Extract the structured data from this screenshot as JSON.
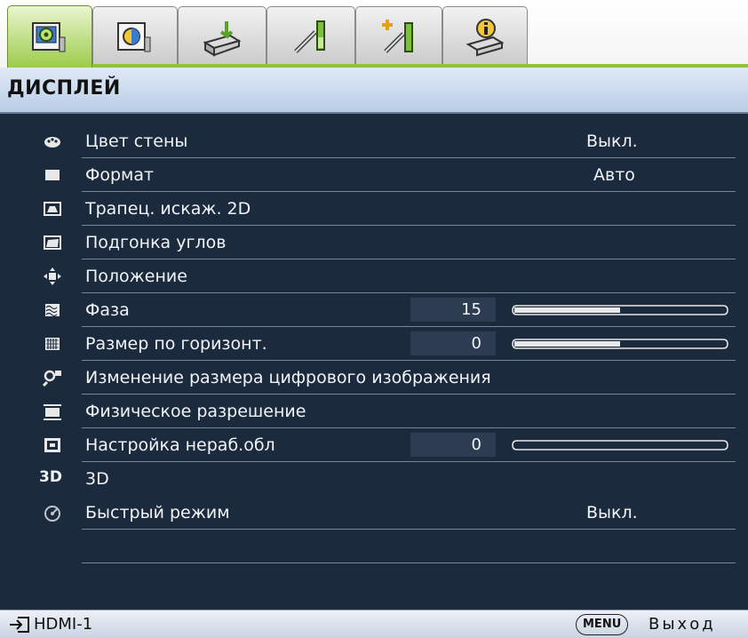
{
  "tabs": [
    {
      "id": "display",
      "icon": "display-settings-icon",
      "active": true
    },
    {
      "id": "picture",
      "icon": "picture-settings-icon",
      "active": false
    },
    {
      "id": "source",
      "icon": "source-input-icon",
      "active": false
    },
    {
      "id": "system-basic",
      "icon": "system-setup-basic-icon",
      "active": false
    },
    {
      "id": "system-advanced",
      "icon": "system-setup-advanced-icon",
      "active": false
    },
    {
      "id": "information",
      "icon": "information-icon",
      "active": false
    }
  ],
  "header": {
    "title": "ДИСПЛЕЙ"
  },
  "menu_items": [
    {
      "icon": "wall-color-icon",
      "label": "Цвет стены",
      "value": "Выкл."
    },
    {
      "icon": "aspect-ratio-icon",
      "label": "Формат",
      "value": "Авто"
    },
    {
      "icon": "keystone-2d-icon",
      "label": "Трапец. искаж. 2D",
      "value": ""
    },
    {
      "icon": "corner-fit-icon",
      "label": "Подгонка углов",
      "value": ""
    },
    {
      "icon": "position-icon",
      "label": "Положение",
      "value": ""
    },
    {
      "icon": "phase-icon",
      "label": "Фаза",
      "number": "15",
      "slider_level": 0.5
    },
    {
      "icon": "h-size-icon",
      "label": "Размер по горизонт.",
      "number": "0",
      "slider_level": 0.5
    },
    {
      "icon": "digital-zoom-icon",
      "label": "Изменение размера цифрового изображения",
      "value": ""
    },
    {
      "icon": "native-resolution-icon",
      "label": "Физическое разрешение",
      "value": ""
    },
    {
      "icon": "overscan-icon",
      "label": "Настройка нераб.обл",
      "number": "0",
      "slider_level": 0.0
    },
    {
      "icon": "3d-icon",
      "label": "3D",
      "value": "",
      "icon_text": "3D"
    },
    {
      "icon": "quick-mode-icon",
      "label": "Быстрый режим",
      "value": "Выкл."
    }
  ],
  "footer": {
    "source_icon": "input-source-icon",
    "source_label": "HDMI-1",
    "menu_button": "MENU",
    "exit_label": "Выход"
  },
  "colors": {
    "background": "#1b2a3d",
    "active_tab": "#9ccb4a",
    "header_bg": "#c9d9ec",
    "text": "#f0f3f7"
  }
}
